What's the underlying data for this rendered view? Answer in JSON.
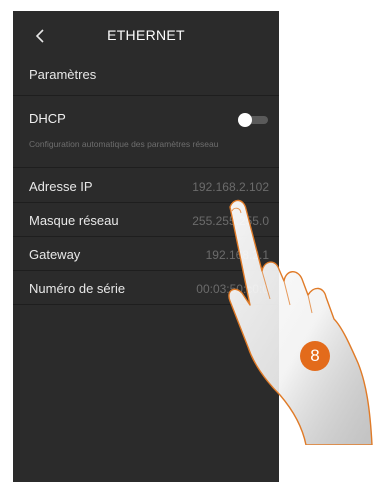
{
  "header": {
    "back_icon": "chevron-left-icon",
    "title": "ETHERNET"
  },
  "section_title": "Paramètres",
  "dhcp": {
    "label": "DHCP",
    "description": "Configuration automatique des paramètres réseau",
    "enabled": false
  },
  "fields": [
    {
      "label": "Adresse IP",
      "value": "192.168.2.102"
    },
    {
      "label": "Masque réseau",
      "value": "255.255.255.0"
    },
    {
      "label": "Gateway",
      "value": "192.168.2.1"
    },
    {
      "label": "Numéro de série",
      "value": "00:03:50:c0:0"
    }
  ],
  "step_badge": "8",
  "colors": {
    "screen_bg": "#2b2b2b",
    "badge": "#e36b1b",
    "hand_outline": "#e07b28"
  },
  "pointer_icon": "hand-pointer-icon"
}
